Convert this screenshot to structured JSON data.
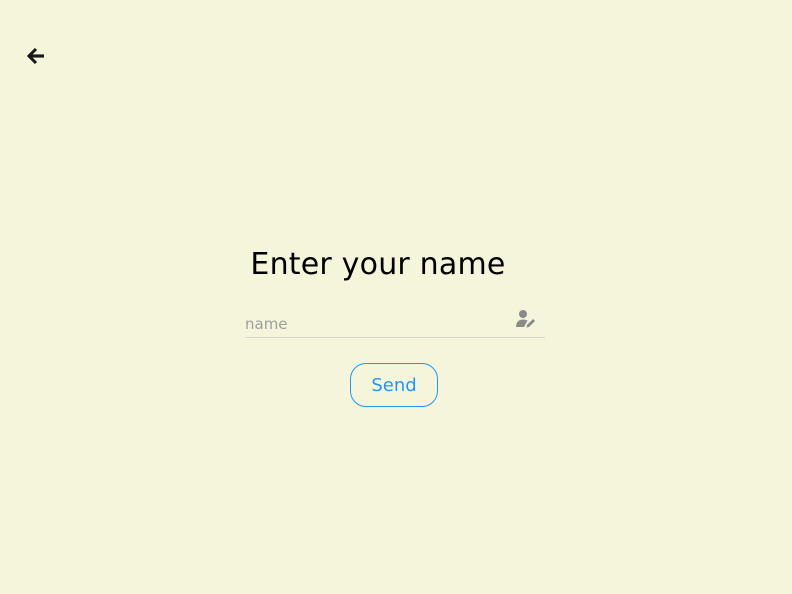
{
  "nav": {
    "back_icon": "arrow-back-icon"
  },
  "form": {
    "title": "Enter your name",
    "name_field": {
      "placeholder": "name",
      "value": "",
      "icon": "person-edit-icon"
    },
    "send_label": "Send"
  },
  "colors": {
    "background": "#f5f5dc",
    "accent": "#2196f3",
    "icon": "#1a1a1a",
    "muted_icon": "#8a8a8a"
  }
}
